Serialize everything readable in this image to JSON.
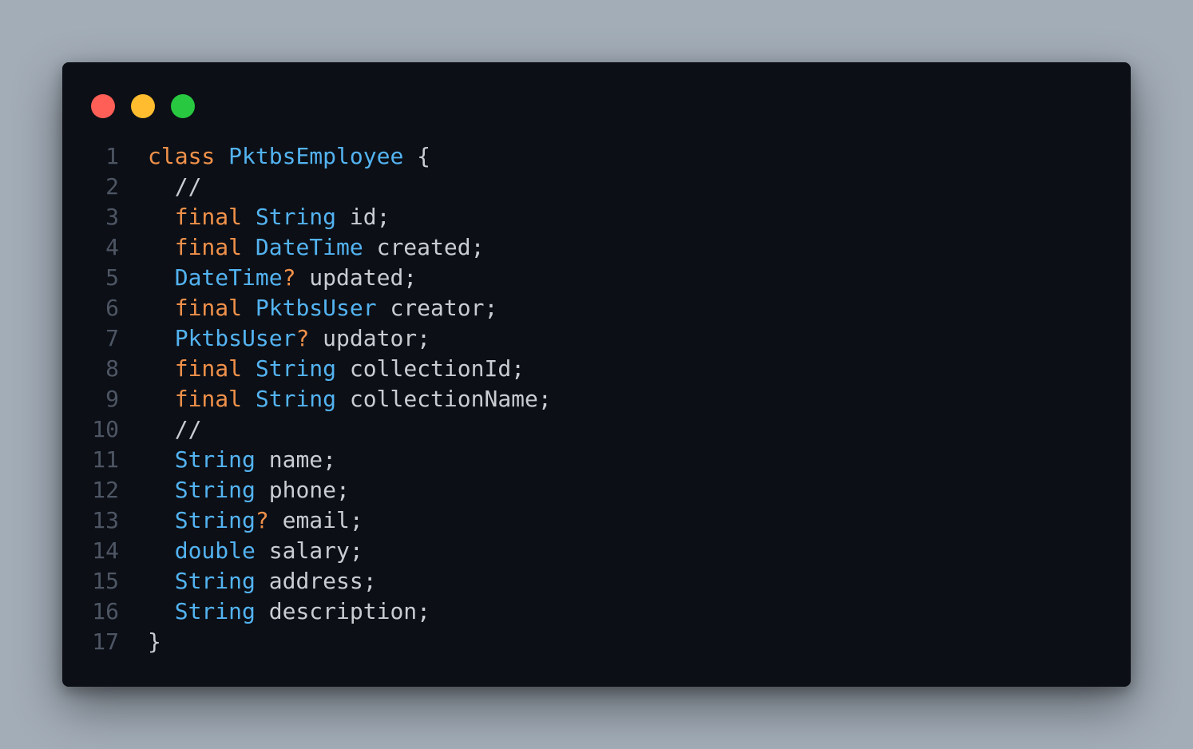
{
  "window": {
    "controls": [
      {
        "name": "close-button",
        "color": "#ff5f57"
      },
      {
        "name": "minimize-button",
        "color": "#febc2e"
      },
      {
        "name": "zoom-button",
        "color": "#28c840"
      }
    ]
  },
  "colors": {
    "background": "#a3adb8",
    "editor": "#0c0f16",
    "line_number": "#4e5664",
    "keyword": "#f0914a",
    "type": "#53b3f1",
    "text": "#c9ccd1"
  },
  "code": {
    "lines": [
      {
        "number": "1",
        "tokens": [
          {
            "t": "class",
            "k": "keyword"
          },
          {
            "t": " "
          },
          {
            "t": "PktbsEmployee",
            "k": "type"
          },
          {
            "t": " {"
          }
        ]
      },
      {
        "number": "2",
        "tokens": [
          {
            "t": "  //"
          }
        ]
      },
      {
        "number": "3",
        "tokens": [
          {
            "t": "  "
          },
          {
            "t": "final",
            "k": "keyword"
          },
          {
            "t": " "
          },
          {
            "t": "String",
            "k": "type"
          },
          {
            "t": " id;"
          }
        ]
      },
      {
        "number": "4",
        "tokens": [
          {
            "t": "  "
          },
          {
            "t": "final",
            "k": "keyword"
          },
          {
            "t": " "
          },
          {
            "t": "DateTime",
            "k": "type"
          },
          {
            "t": " created;"
          }
        ]
      },
      {
        "number": "5",
        "tokens": [
          {
            "t": "  "
          },
          {
            "t": "DateTime",
            "k": "type"
          },
          {
            "t": "?",
            "k": "keyword"
          },
          {
            "t": " updated;"
          }
        ]
      },
      {
        "number": "6",
        "tokens": [
          {
            "t": "  "
          },
          {
            "t": "final",
            "k": "keyword"
          },
          {
            "t": " "
          },
          {
            "t": "PktbsUser",
            "k": "type"
          },
          {
            "t": " creator;"
          }
        ]
      },
      {
        "number": "7",
        "tokens": [
          {
            "t": "  "
          },
          {
            "t": "PktbsUser",
            "k": "type"
          },
          {
            "t": "?",
            "k": "keyword"
          },
          {
            "t": " updator;"
          }
        ]
      },
      {
        "number": "8",
        "tokens": [
          {
            "t": "  "
          },
          {
            "t": "final",
            "k": "keyword"
          },
          {
            "t": " "
          },
          {
            "t": "String",
            "k": "type"
          },
          {
            "t": " collectionId;"
          }
        ]
      },
      {
        "number": "9",
        "tokens": [
          {
            "t": "  "
          },
          {
            "t": "final",
            "k": "keyword"
          },
          {
            "t": " "
          },
          {
            "t": "String",
            "k": "type"
          },
          {
            "t": " collectionName;"
          }
        ]
      },
      {
        "number": "10",
        "tokens": [
          {
            "t": "  //"
          }
        ]
      },
      {
        "number": "11",
        "tokens": [
          {
            "t": "  "
          },
          {
            "t": "String",
            "k": "type"
          },
          {
            "t": " name;"
          }
        ]
      },
      {
        "number": "12",
        "tokens": [
          {
            "t": "  "
          },
          {
            "t": "String",
            "k": "type"
          },
          {
            "t": " phone;"
          }
        ]
      },
      {
        "number": "13",
        "tokens": [
          {
            "t": "  "
          },
          {
            "t": "String",
            "k": "type"
          },
          {
            "t": "?",
            "k": "keyword"
          },
          {
            "t": " email;"
          }
        ]
      },
      {
        "number": "14",
        "tokens": [
          {
            "t": "  "
          },
          {
            "t": "double",
            "k": "type"
          },
          {
            "t": " salary;"
          }
        ]
      },
      {
        "number": "15",
        "tokens": [
          {
            "t": "  "
          },
          {
            "t": "String",
            "k": "type"
          },
          {
            "t": " address;"
          }
        ]
      },
      {
        "number": "16",
        "tokens": [
          {
            "t": "  "
          },
          {
            "t": "String",
            "k": "type"
          },
          {
            "t": " description;"
          }
        ]
      },
      {
        "number": "17",
        "tokens": [
          {
            "t": "}"
          }
        ]
      }
    ]
  }
}
